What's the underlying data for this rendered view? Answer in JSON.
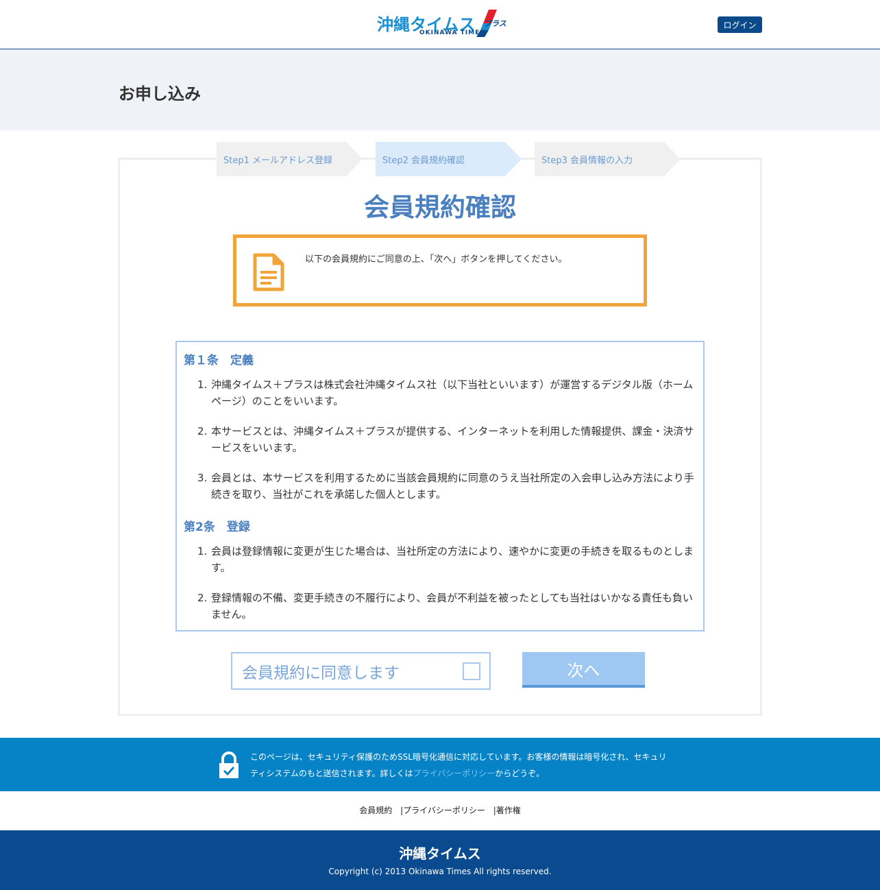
{
  "header": {
    "logo_main": "沖縄タイムス",
    "logo_plus": "プラス",
    "logo_sub": "OKINAWA TIMES",
    "login_label": "ログイン"
  },
  "page_title": "お申し込み",
  "steps": [
    {
      "label": "Step1 メールアドレス登録"
    },
    {
      "label": "Step2 会員規約確認"
    },
    {
      "label": "Step3 会員情報の入力"
    }
  ],
  "section_title": "会員規約確認",
  "notice_text": "以下の会員規約にご同意の上、「次へ」ボタンを押してください。",
  "terms": {
    "articles": [
      {
        "title": "第１条　定義",
        "items": [
          {
            "num": "1.",
            "text": "沖縄タイムス＋プラスは株式会社沖縄タイムス社（以下当社といいます）が運営するデジタル版（ホームページ）のことをいいます。"
          },
          {
            "num": "2.",
            "text": "本サービスとは、沖縄タイムス＋プラスが提供する、インターネットを利用した情報提供、課金・決済サービスをいいます。"
          },
          {
            "num": "3.",
            "text": "会員とは、本サービスを利用するために当該会員規約に同意のうえ当社所定の入会申し込み方法により手続きを取り、当社がこれを承諾した個人とします。"
          }
        ]
      },
      {
        "title": "第2条　登録",
        "items": [
          {
            "num": "1.",
            "text": "会員は登録情報に変更が生じた場合は、当社所定の方法により、速やかに変更の手続きを取るものとします。"
          },
          {
            "num": "2.",
            "text": "登録情報の不備、変更手続きの不履行により、会員が不利益を被ったとしても当社はいかなる責任も負いません。"
          }
        ]
      }
    ]
  },
  "agree_label": "会員規約に同意します",
  "next_label": "次へ",
  "ssl": {
    "text_before": "このページは、セキュリティ保護のためSSL暗号化通信に対応しています。お客様の情報は暗号化され、セキュリティシステムのもと送信されます。詳しくは",
    "link": "プライバシーポリシー",
    "text_after": "からどうぞ。"
  },
  "footer_links": [
    "会員規約",
    "|プライバシーポリシー",
    "|著作権"
  ],
  "footer": {
    "logo": "沖縄タイムス",
    "copyright": "Copyright (c) 2013 Okinawa Times All rights reserved."
  },
  "colors": {
    "brand_navy": "#0b4a8a",
    "brand_blue": "#1a8fd0",
    "accent_orange": "#f0a43a",
    "step_active": "#dcebfc",
    "ssl_band": "#0583c6"
  }
}
